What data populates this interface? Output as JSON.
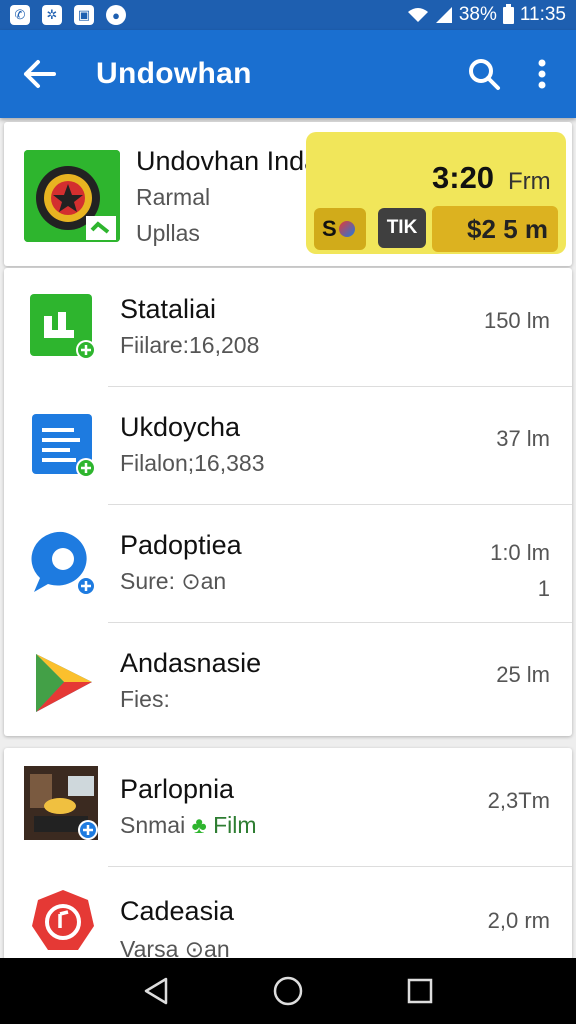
{
  "status_bar": {
    "battery": "38%",
    "time": "11:35",
    "left_icons": [
      "phone-icon",
      "settings-icon",
      "chat-icon",
      "app-icon"
    ]
  },
  "app_bar": {
    "title": "Undowhan",
    "icons": [
      "back-arrow-icon",
      "search-icon",
      "more-vert-icon"
    ]
  },
  "featured": {
    "title": "Undovhan Indanii",
    "sub1": "Rarmal",
    "sub2": "Upllas",
    "time": "3:20",
    "unit": "Frm",
    "chip_a": "S",
    "chip_b": "TIK",
    "price": "$2 5 m",
    "panel_color": "#f1e65a"
  },
  "list": [
    {
      "title": "Stataliai",
      "sub": "Fiilare:16,208",
      "meta": "150 lm",
      "meta2": "",
      "icon": "green-chart-icon"
    },
    {
      "title": "Ukdoycha",
      "sub": "Filalon;16,383",
      "meta": "37 lm",
      "meta2": "",
      "icon": "blue-document-icon"
    },
    {
      "title": "Padoptiea",
      "sub": "Sure: ⊙an",
      "meta": "1:0 lm",
      "meta2": "1",
      "icon": "blue-chat-icon"
    },
    {
      "title": "Andasnasie",
      "sub": "Fies:",
      "meta": "25 lm",
      "meta2": "",
      "icon": "play-triangle-icon"
    },
    {
      "title": "Parlopnia",
      "sub": "Snmai",
      "sub_highlight": "Film",
      "meta": "2,3Tm",
      "meta2": "",
      "icon": "photo-thumbnail-icon"
    },
    {
      "title": "Cadeasia",
      "sub": "Varsa ⊙an",
      "meta": "2,0 rm",
      "meta2": "",
      "icon": "red-music-icon"
    }
  ],
  "colors": {
    "app_bar": "#1a6fd0",
    "status_bar": "#1e5fb0",
    "green": "#2eb52e",
    "blue": "#1e7be0",
    "red": "#e53935"
  }
}
